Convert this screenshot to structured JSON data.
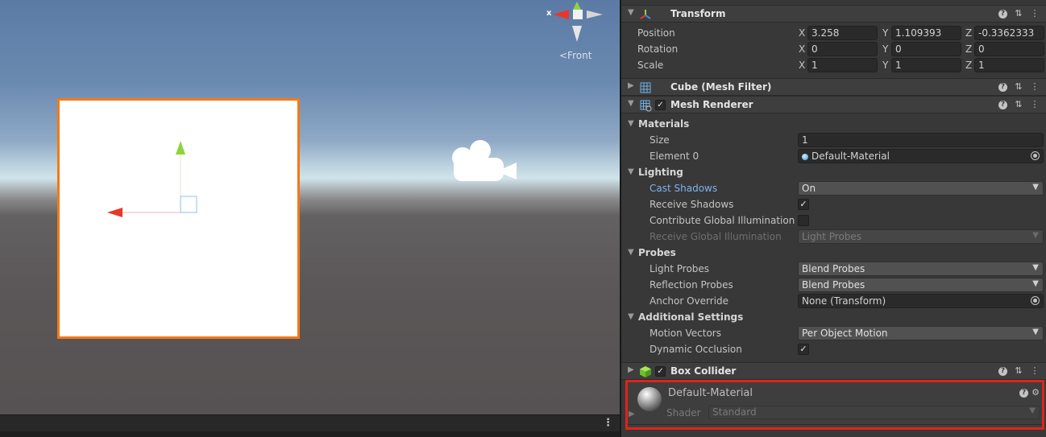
{
  "scene": {
    "orientation_axis_label": "x",
    "orientation_view_label": "<Front",
    "icons": [
      "move-gizmo-y-arrow",
      "move-gizmo-x-arrow",
      "camera-icon",
      "orientation-gizmo"
    ],
    "colors": {
      "selection_outline": "#f27a16",
      "gizmo_x": "#e8372b",
      "gizmo_y": "#8fd43a",
      "gizmo_z": "#3b88e0"
    }
  },
  "transform": {
    "title": "Transform",
    "position": {
      "label": "Position",
      "x": "3.258",
      "y": "1.109393",
      "z": "-0.3362333"
    },
    "rotation": {
      "label": "Rotation",
      "x": "0",
      "y": "0",
      "z": "0"
    },
    "scale": {
      "label": "Scale",
      "x": "1",
      "y": "1",
      "z": "1"
    },
    "axis_labels": {
      "x": "X",
      "y": "Y",
      "z": "Z"
    }
  },
  "mesh_filter": {
    "title": "Cube (Mesh Filter)"
  },
  "mesh_renderer": {
    "title": "Mesh Renderer",
    "enabled": true,
    "materials": {
      "label": "Materials",
      "size_label": "Size",
      "size_value": "1",
      "element0_label": "Element 0",
      "element0_value": "Default-Material"
    },
    "lighting": {
      "label": "Lighting",
      "cast_shadows_label": "Cast Shadows",
      "cast_shadows_value": "On",
      "receive_shadows_label": "Receive Shadows",
      "receive_shadows_checked": true,
      "contribute_gi_label": "Contribute Global Illumination",
      "contribute_gi_checked": false,
      "receive_gi_label": "Receive Global Illumination",
      "receive_gi_value": "Light Probes"
    },
    "probes": {
      "label": "Probes",
      "light_probes_label": "Light Probes",
      "light_probes_value": "Blend Probes",
      "reflection_probes_label": "Reflection Probes",
      "reflection_probes_value": "Blend Probes",
      "anchor_override_label": "Anchor Override",
      "anchor_override_value": "None (Transform)"
    },
    "additional": {
      "label": "Additional Settings",
      "motion_vectors_label": "Motion Vectors",
      "motion_vectors_value": "Per Object Motion",
      "dynamic_occlusion_label": "Dynamic Occlusion",
      "dynamic_occlusion_checked": true
    }
  },
  "box_collider": {
    "title": "Box Collider",
    "enabled": true
  },
  "material": {
    "name": "Default-Material",
    "shader_label": "Shader",
    "shader_value": "Standard"
  },
  "glyphs": {
    "check": "✓",
    "caret": "▼",
    "fold_open": "▼",
    "fold_closed": "▶",
    "help": "?",
    "presets": "⇅",
    "more": "⋮",
    "gear": "⚙"
  }
}
